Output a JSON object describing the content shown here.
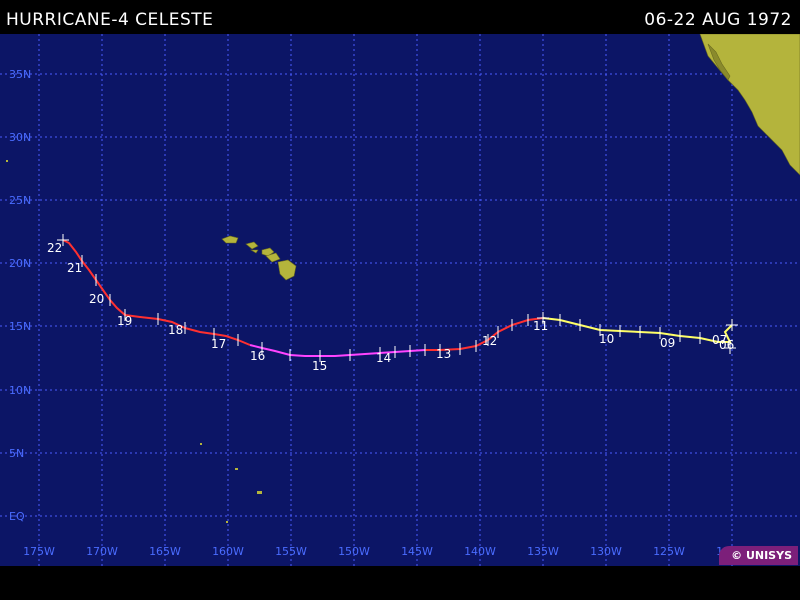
{
  "header": {
    "storm_title": "HURRICANE-4  CELESTE",
    "date_range": "06-22 AUG 1972"
  },
  "map": {
    "ocean_color": "#0c1566",
    "land_color": "#b4b43c",
    "grid_color": "#4a5cff",
    "lat_labels": [
      "35N",
      "30N",
      "25N",
      "20N",
      "15N",
      "10N",
      "5N",
      "EQ"
    ],
    "lon_labels": [
      "175W",
      "170W",
      "165W",
      "160W",
      "155W",
      "150W",
      "145W",
      "140W",
      "135W",
      "130W",
      "125W",
      "120W"
    ],
    "day_labels": [
      "22",
      "21",
      "20",
      "19",
      "18",
      "17",
      "16",
      "15",
      "14",
      "13",
      "12",
      "11",
      "10",
      "09",
      "07",
      "06"
    ],
    "track_segments": [
      {
        "stage": "tropical storm",
        "color": "#ffff66"
      },
      {
        "stage": "hurricane cat 1",
        "color": "#ff3030"
      },
      {
        "stage": "hurricane cat 4",
        "color": "#ff44ff"
      }
    ]
  },
  "credit": "© UNISYS"
}
